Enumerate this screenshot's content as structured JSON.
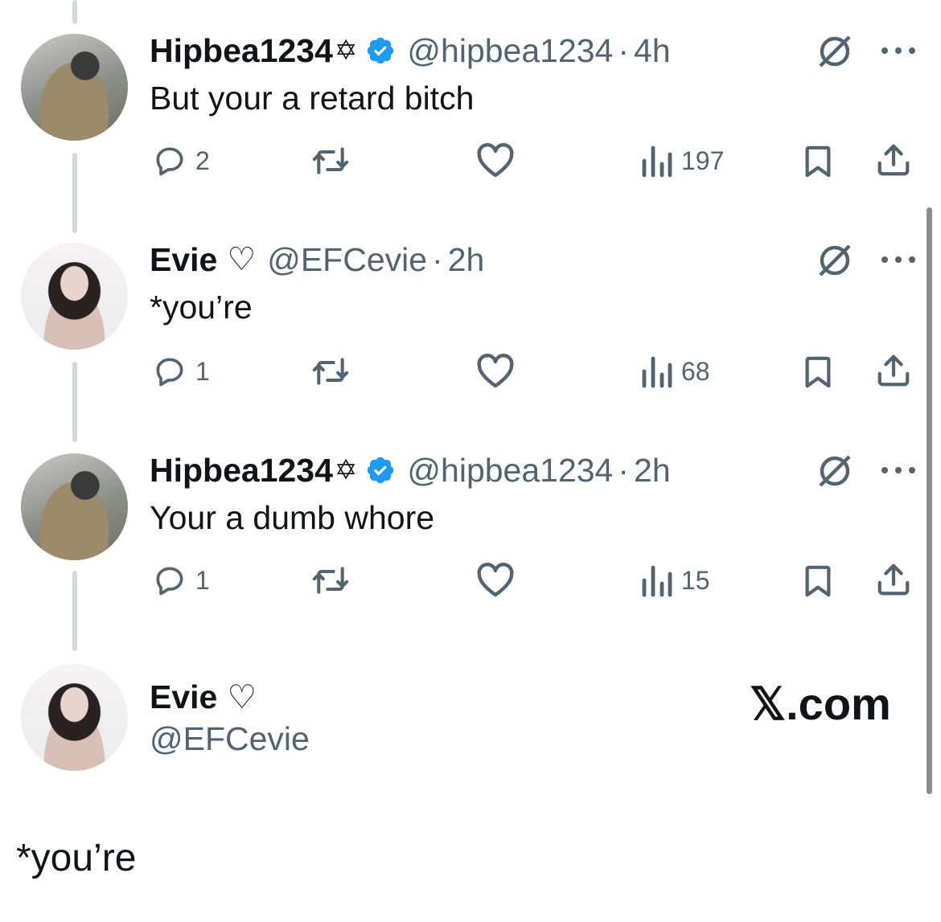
{
  "tweets": [
    {
      "name": "Hipbea1234",
      "name_symbol": "✡",
      "verified": true,
      "handle": "@hipbea1234",
      "separator": "·",
      "time": "4h",
      "text": "But your a retard bitch",
      "replies": "2",
      "views": "197"
    },
    {
      "name": "Evie",
      "name_symbol": "♡",
      "verified": false,
      "handle": "@EFCevie",
      "separator": "·",
      "time": "2h",
      "text": "*you’re",
      "replies": "1",
      "views": "68"
    },
    {
      "name": "Hipbea1234",
      "name_symbol": "✡",
      "verified": true,
      "handle": "@hipbea1234",
      "separator": "·",
      "time": "2h",
      "text": "Your a dumb whore",
      "replies": "1",
      "views": "15"
    }
  ],
  "main_tweet": {
    "name": "Evie",
    "name_symbol": "♡",
    "handle": "@EFCevie",
    "text": "*you’re"
  },
  "branding": {
    "site": "𝕏.com"
  },
  "colors": {
    "verified": "#1d9bf0",
    "muted": "#536471",
    "text": "#0f1419",
    "thread_line": "#cfd9de"
  },
  "icons": [
    "reply-icon",
    "retweet-icon",
    "like-icon",
    "views-icon",
    "bookmark-icon",
    "share-icon",
    "grok-icon",
    "more-icon",
    "verified-icon"
  ]
}
